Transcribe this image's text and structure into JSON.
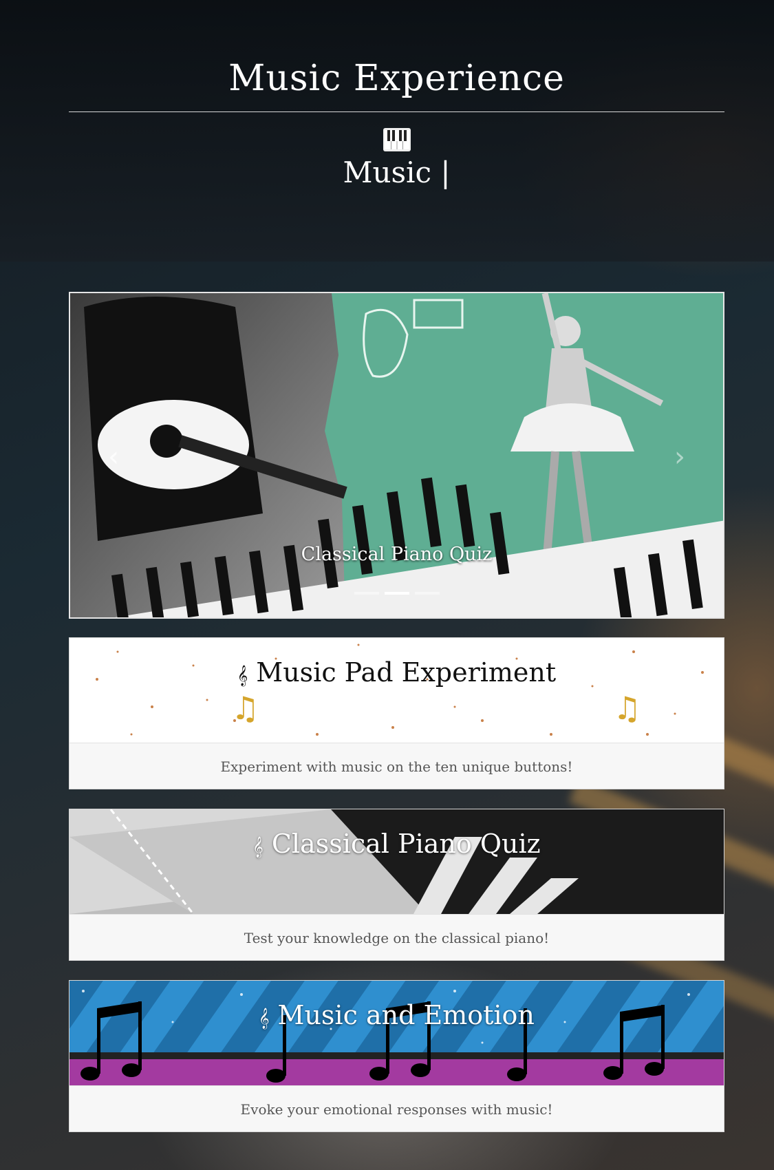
{
  "header": {
    "title": "Music Experience",
    "typed_text": "Music |"
  },
  "carousel": {
    "caption": "Classical Piano Quiz",
    "slide_count": 3,
    "active_index": 1
  },
  "cards": [
    {
      "title": "Music Pad Experiment",
      "clef": "𝄞",
      "description": "Experiment with music on the ten unique buttons!"
    },
    {
      "title": "Classical Piano Quiz",
      "clef": "𝄞",
      "description": "Test your knowledge on the classical piano!"
    },
    {
      "title": "Music and Emotion",
      "clef": "𝄞",
      "description": "Evoke your emotional responses with music!"
    }
  ],
  "icons": {
    "keys": "piano-keys-icon",
    "prev": "chevron-left-icon",
    "next": "chevron-right-icon",
    "clef": "treble-clef-icon"
  }
}
